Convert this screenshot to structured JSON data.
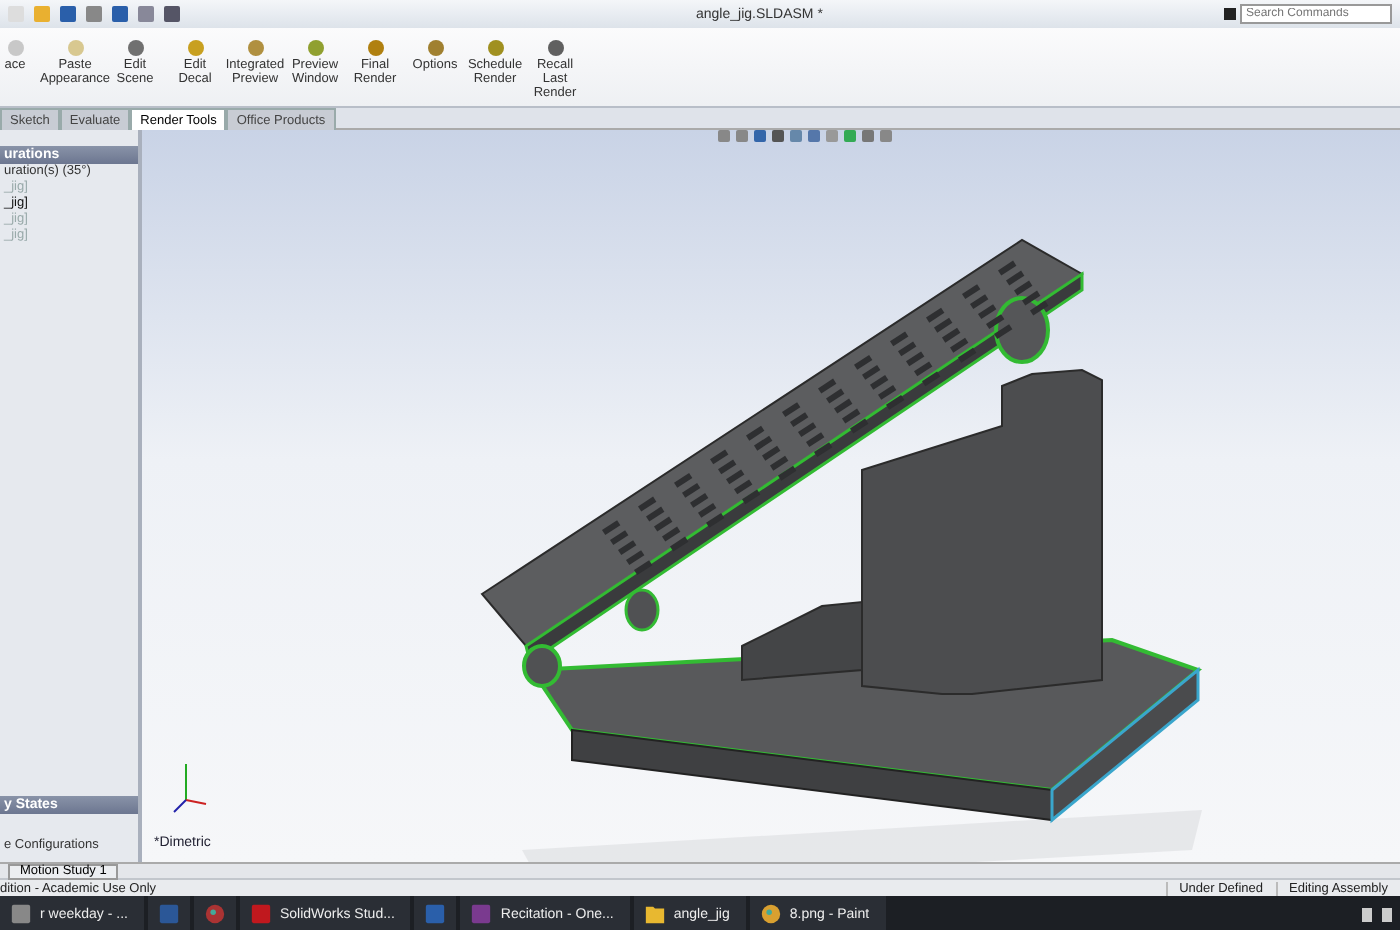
{
  "window": {
    "title": "angle_jig.SLDASM *"
  },
  "search": {
    "placeholder": "Search Commands"
  },
  "ribbon": {
    "buttons": [
      {
        "label": "ace"
      },
      {
        "label": "Paste Appearance"
      },
      {
        "label": "Edit Scene"
      },
      {
        "label": "Edit Decal"
      },
      {
        "label": "Integrated Preview"
      },
      {
        "label": "Preview Window"
      },
      {
        "label": "Final Render"
      },
      {
        "label": "Options"
      },
      {
        "label": "Schedule Render"
      },
      {
        "label": "Recall Last Render"
      }
    ]
  },
  "command_tabs": [
    {
      "label": "Sketch",
      "selected": false
    },
    {
      "label": "Evaluate",
      "selected": false
    },
    {
      "label": "Render Tools",
      "selected": true
    },
    {
      "label": "Office Products",
      "selected": false
    }
  ],
  "feature_tree": {
    "header": "urations",
    "config": "uration(s) (35°)",
    "items": [
      {
        "label": "_jig]",
        "active": false
      },
      {
        "label": "_jig]",
        "active": true
      },
      {
        "label": "_jig]",
        "active": false
      },
      {
        "label": "_jig]",
        "active": false
      }
    ],
    "states_header": "y States",
    "states_item": "e Configurations"
  },
  "viewport": {
    "view_label": "*Dimetric"
  },
  "bottom_tabs": [
    {
      "label": "Motion Study 1",
      "selected": true
    }
  ],
  "status_bar": {
    "left": "dition - Academic Use Only",
    "items": [
      "Under Defined",
      "Editing Assembly"
    ]
  },
  "taskbar": {
    "apps": [
      {
        "kind": "browser",
        "label": "r weekday - ..."
      },
      {
        "kind": "word"
      },
      {
        "kind": "atom"
      },
      {
        "kind": "solidworks",
        "label": "SolidWorks Stud..."
      },
      {
        "kind": "star"
      },
      {
        "kind": "onenote",
        "label": "Recitation - One..."
      },
      {
        "kind": "folder",
        "label": "angle_jig"
      },
      {
        "kind": "paint",
        "label": "8.png - Paint"
      }
    ]
  }
}
